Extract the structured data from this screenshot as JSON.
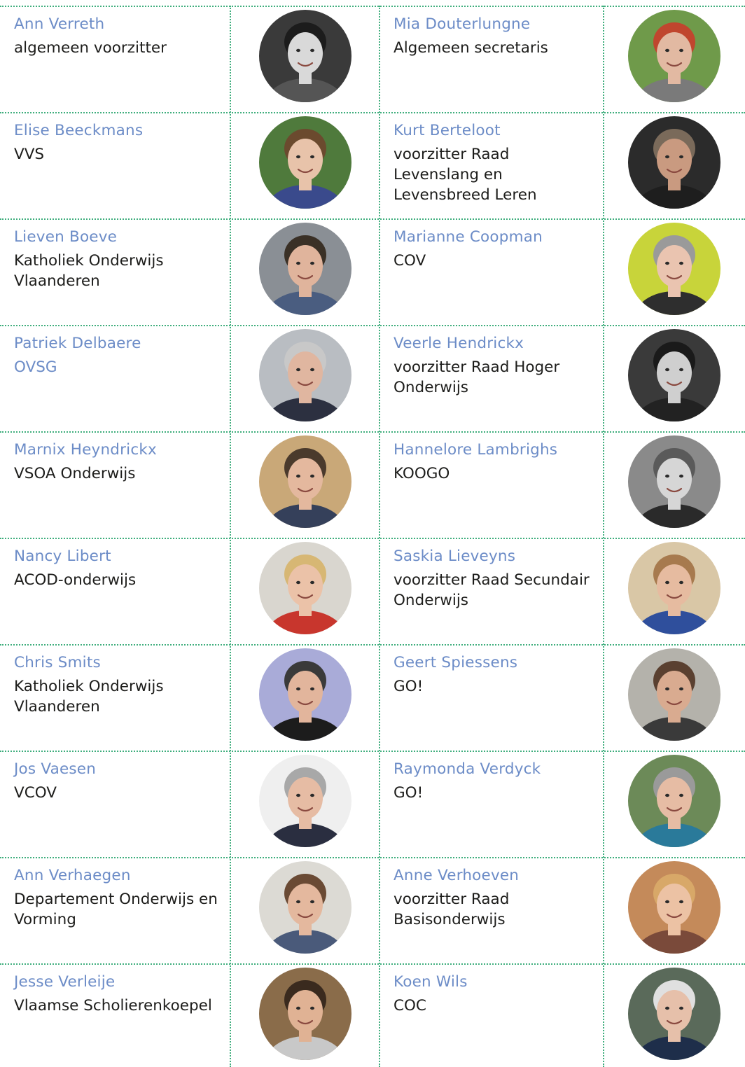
{
  "rows": [
    {
      "left": {
        "name": "Ann Verreth",
        "role": "algemeen voorzitter",
        "bg": "#3a3a3a",
        "skin": "#d9d9d9",
        "hair": "#1c1c1c",
        "shirt": "#555555"
      },
      "right": {
        "name": "Mia Douterlungne",
        "role": "Algemeen secretaris",
        "bg": "#6f9a4a",
        "skin": "#e2b9a2",
        "hair": "#c0462e",
        "shirt": "#7a7a7a"
      }
    },
    {
      "left": {
        "name": "Elise Beeckmans",
        "role": "VVS",
        "bg": "#4f7a3c",
        "skin": "#e8c3aa",
        "hair": "#6b4a2e",
        "shirt": "#3a4a8c"
      },
      "right": {
        "name": "Kurt Berteloot",
        "role": "voorzitter Raad Levenslang en Levensbreed Leren",
        "bg": "#2b2b2b",
        "skin": "#c99a80",
        "hair": "#7a6a5a",
        "shirt": "#1e1e1e"
      }
    },
    {
      "left": {
        "name": "Lieven Boeve",
        "role": "Katholiek Onderwijs Vlaanderen",
        "bg": "#8a8f95",
        "skin": "#e0b49c",
        "hair": "#3a3026",
        "shirt": "#4a5d80"
      },
      "right": {
        "name": "Marianne Coopman",
        "role": "COV",
        "bg": "#c8d43a",
        "skin": "#eac4b0",
        "hair": "#9a9a9a",
        "shirt": "#2e2e2e"
      }
    },
    {
      "left": {
        "name": "Patriek Delbaere",
        "role": "OVSG",
        "role_link": true,
        "bg": "#b9bdc2",
        "skin": "#e0b6a0",
        "hair": "#c8c8c8",
        "shirt": "#2c3040"
      },
      "right": {
        "name": "Veerle Hendrickx",
        "role": "voorzitter Raad Hoger Onderwijs",
        "bg": "#3a3a3a",
        "skin": "#cfcfcf",
        "hair": "#1a1a1a",
        "shirt": "#222222"
      }
    },
    {
      "left": {
        "name": "Marnix Heyndrickx",
        "role": "VSOA Onderwijs",
        "bg": "#c9a878",
        "skin": "#e4b89e",
        "hair": "#4a3a2c",
        "shirt": "#35405a"
      },
      "right": {
        "name": "Hannelore Lambrighs",
        "role": "KOOGO",
        "bg": "#8a8a8a",
        "skin": "#d6d6d6",
        "hair": "#5a5a5a",
        "shirt": "#2a2a2a"
      }
    },
    {
      "left": {
        "name": "Nancy Libert",
        "role": "ACOD-onderwijs",
        "bg": "#d9d6cf",
        "skin": "#ebc2a8",
        "hair": "#d7b774",
        "shirt": "#c8362d"
      },
      "right": {
        "name": "Saskia Lieveyns",
        "role": "voorzitter Raad Secundair Onderwijs",
        "bg": "#d9c7a6",
        "skin": "#e6bba0",
        "hair": "#a77a4e",
        "shirt": "#2f4f9c"
      }
    },
    {
      "left": {
        "name": "Chris Smits",
        "role": "Katholiek Onderwijs Vlaanderen",
        "bg": "#a9abd8",
        "skin": "#e2b59c",
        "hair": "#3a3a3a",
        "shirt": "#1c1c1c"
      },
      "right": {
        "name": "Geert Spiessens",
        "role": "GO!",
        "bg": "#b4b2ab",
        "skin": "#d9ab90",
        "hair": "#5a4030",
        "shirt": "#3a3a3a"
      }
    },
    {
      "left": {
        "name": "Jos Vaesen",
        "role": "VCOV",
        "bg": "#efefef",
        "skin": "#e6bca4",
        "hair": "#a8a8a8",
        "shirt": "#2a2e40"
      },
      "right": {
        "name": "Raymonda Verdyck",
        "role": "GO!",
        "bg": "#6c8a58",
        "skin": "#e6bca4",
        "hair": "#9a9a9a",
        "shirt": "#2a7a9a"
      }
    },
    {
      "left": {
        "name": "Ann Verhaegen",
        "role": "Departement Onderwijs en Vorming",
        "bg": "#dcdad4",
        "skin": "#e4b89e",
        "hair": "#6a4a34",
        "shirt": "#4a5a7a"
      },
      "right": {
        "name": "Anne Verhoeven",
        "role": "voorzitter Raad Basisonderwijs",
        "bg": "#c48a5a",
        "skin": "#ecc2a4",
        "hair": "#d8a868",
        "shirt": "#7a4a3a"
      }
    },
    {
      "left": {
        "name": "Jesse Verleije",
        "role": "Vlaamse Scholierenkoepel",
        "bg": "#8a6c4a",
        "skin": "#e0b294",
        "hair": "#3a2a1e",
        "shirt": "#c8c8c8"
      },
      "right": {
        "name": "Koen Wils",
        "role": "COC",
        "bg": "#5a6a5a",
        "skin": "#e6c0aa",
        "hair": "#e0e0e0",
        "shirt": "#1e2e4a"
      }
    }
  ]
}
